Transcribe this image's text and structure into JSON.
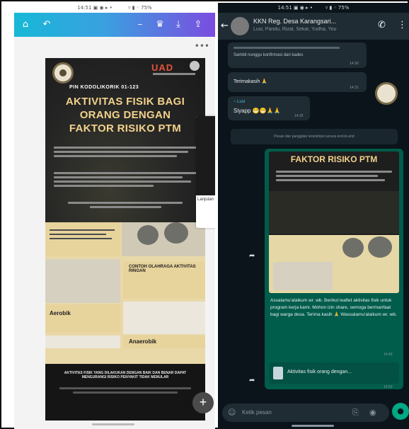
{
  "left_screen": {
    "status_bar": "14:51 ▣ ◉ ▸ •",
    "status_right": "▿ ▮ ◦ 75%",
    "icons": {
      "home": "home-icon",
      "undo": "undo-icon",
      "minus": "minus-icon",
      "crown": "crown-icon",
      "download": "download-icon",
      "share": "share-icon",
      "more": "more-icon",
      "add": "add-icon"
    },
    "poster": {
      "brand": "UAD",
      "tag": "PIN KODOLIKORIK 01-123",
      "title_line1": "AKTIVITAS FISIK BAGI",
      "title_line2": "ORANG DENGAN",
      "title_line3": "FAKTOR RISIKO PTM",
      "label_aerobik": "Aerobik",
      "label_anaerobik": "Anaerobik",
      "label_contoh": "CONTOH OLAHRAGA AKTIVITAS RINGAN",
      "bottom_text": "AKTIVITAS FISIK YANG DILAKUKAN DENGAN BAIK DAN BENAR DAPAT MENGURANGI RISIKO PENYAKIT TIDAK MENULAR"
    },
    "next_page_label": "Lanjutan"
  },
  "right_screen": {
    "status_bar": "14:51 ▣ ◉ ▸ •",
    "status_right": "▿ ▮ ◦ 75%",
    "chat_title": "KKN Reg. Desa Karangsari...",
    "chat_subtitle": "Lusi, Pandu, Rizal, Sekar, Yudha, You",
    "messages": [
      {
        "text": "Sambil nunggu konfirmasi dari kades",
        "time": "14:30"
      },
      {
        "text": "Terimakasih 🙏",
        "time": "14:31"
      },
      {
        "sender": "~ Lusi",
        "text": "Siyapp 😁😁🙏🙏",
        "time": "14:32"
      }
    ],
    "system_text": "Pesan dan panggilan terenkripsi secara end-to-end",
    "forward_title": "FAKTOR RISIKO PTM",
    "caption": "Assalamu'alaikum wr. wb. Berikut leaflet aktivitas fisik untuk program kerja kami. Mohon izin share, semoga bermanfaat bagi warga desa. Terima kasih 🙏 Wassalamu'alaikum wr. wb.",
    "caption_time": "14:49",
    "doc_name": "Aktivitas fisik orang dengan...",
    "doc_time": "14:50",
    "input_placeholder": "Ketik pesan",
    "icons": {
      "back": "back-icon",
      "call": "add-call-icon",
      "menu": "menu-icon",
      "emoji": "emoji-icon",
      "attach": "attach-icon",
      "camera": "camera-icon",
      "mic": "mic-icon"
    }
  }
}
